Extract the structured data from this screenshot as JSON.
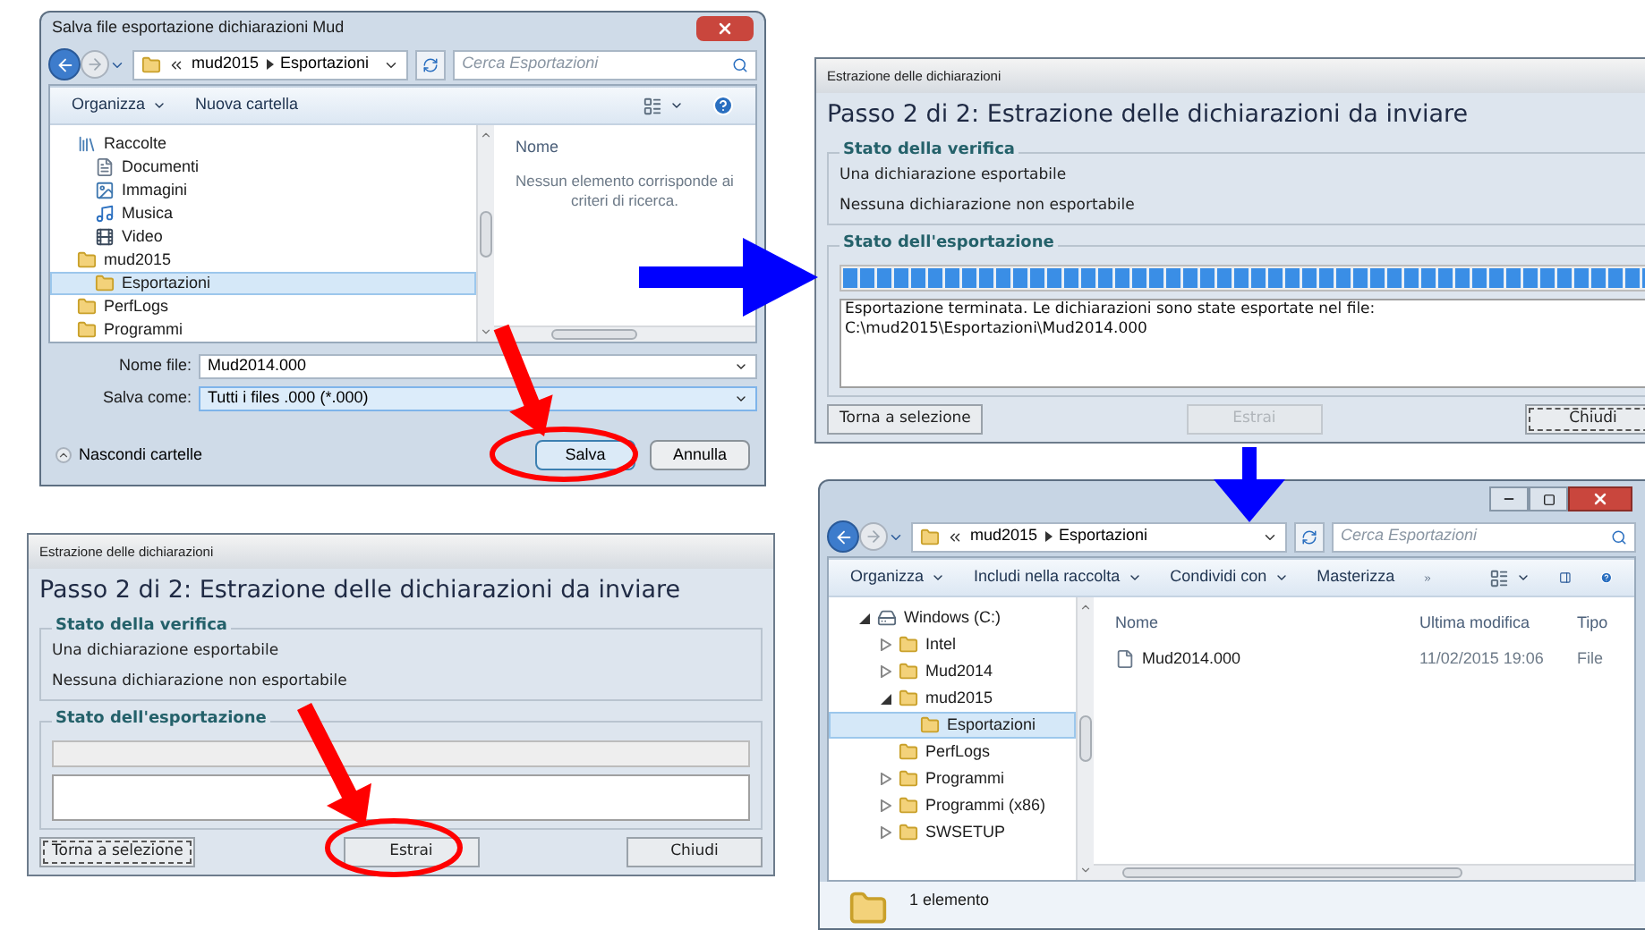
{
  "save_dialog": {
    "title": "Salva file esportazione dichiarazioni Mud",
    "breadcrumb": [
      "mud2015",
      "Esportazioni"
    ],
    "search_placeholder": "Cerca Esportazioni",
    "toolbar": [
      {
        "label": "Organizza",
        "dropdown": true
      },
      {
        "label": "Nuova cartella",
        "dropdown": false
      }
    ],
    "tree": [
      {
        "label": "Raccolte",
        "kind": "library",
        "selected": false,
        "children": [
          {
            "label": "Documenti",
            "kind": "document",
            "selected": false
          },
          {
            "label": "Immagini",
            "kind": "picture",
            "selected": false
          },
          {
            "label": "Musica",
            "kind": "music",
            "selected": false
          },
          {
            "label": "Video",
            "kind": "video",
            "selected": false
          }
        ]
      },
      {
        "label": "mud2015",
        "kind": "folder",
        "selected": false,
        "children": [
          {
            "label": "Esportazioni",
            "kind": "folder",
            "selected": true
          }
        ]
      },
      {
        "label": "PerfLogs",
        "kind": "folder",
        "selected": false
      },
      {
        "label": "Programmi",
        "kind": "folder",
        "selected": false
      }
    ],
    "column": "Nome",
    "empty_message": "Nessun elemento corrisponde ai criteri di ricerca.",
    "file_name": {
      "label": "Nome file:",
      "value": "Mud2014.000"
    },
    "save_as": {
      "label": "Salva come:",
      "value": "Tutti i files .000 (*.000)"
    },
    "hide_folders": "Nascondi cartelle",
    "buttons": [
      {
        "label": "Salva",
        "default": true
      },
      {
        "label": "Annulla",
        "default": false
      }
    ]
  },
  "completed_window": {
    "title": "Estrazione delle dichiarazioni",
    "heading": "Passo 2 di 2: Estrazione delle dichiarazioni da inviare",
    "verification_title": "Stato della verifica",
    "verification_lines": [
      "Una dichiarazione esportabile",
      "Nessuna dichiarazione non esportabile"
    ],
    "export_title": "Stato dell'esportazione",
    "progress": {
      "level": 1
    },
    "message_lines": [
      "Esportazione terminata. Le dichiarazioni sono state esportate nel file:",
      "C:\\mud2015\\Esportazioni\\Mud2014.000"
    ],
    "buttons": [
      {
        "label": "Torna a selezione",
        "disabled": false,
        "focused": false
      },
      {
        "label": "Estrai",
        "disabled": true,
        "focused": false
      },
      {
        "label": "Chiudi",
        "disabled": false,
        "focused": true
      }
    ]
  },
  "start_window": {
    "title": "Estrazione delle dichiarazioni",
    "heading": "Passo 2 di 2: Estrazione delle dichiarazioni da inviare",
    "verification_title": "Stato della verifica",
    "verification_lines": [
      "Una dichiarazione esportabile",
      "Nessuna dichiarazione non esportabile"
    ],
    "export_title": "Stato dell'esportazione",
    "progress": {
      "level": 0
    },
    "buttons": [
      {
        "label": "Torna a selezione",
        "disabled": false,
        "focused": true
      },
      {
        "label": "Estrai",
        "disabled": false,
        "focused": false
      },
      {
        "label": "Chiudi",
        "disabled": false,
        "focused": false
      }
    ]
  },
  "explorer": {
    "breadcrumb": [
      "mud2015",
      "Esportazioni"
    ],
    "search_placeholder": "Cerca Esportazioni",
    "toolbar": [
      {
        "label": "Organizza",
        "dropdown": true
      },
      {
        "label": "Includi nella raccolta",
        "dropdown": true
      },
      {
        "label": "Condividi con",
        "dropdown": true
      },
      {
        "label": "Masterizza",
        "dropdown": false
      }
    ],
    "tree": [
      {
        "label": "Windows (C:)",
        "kind": "drive",
        "selected": false,
        "expanded": true,
        "children": [
          {
            "label": "Intel",
            "kind": "folder",
            "selected": false,
            "expanded": false
          },
          {
            "label": "Mud2014",
            "kind": "folder",
            "selected": false,
            "expanded": false
          },
          {
            "label": "mud2015",
            "kind": "folder",
            "selected": false,
            "expanded": true,
            "children": [
              {
                "label": "Esportazioni",
                "kind": "folder",
                "selected": true
              }
            ]
          },
          {
            "label": "PerfLogs",
            "kind": "folder",
            "selected": false
          },
          {
            "label": "Programmi",
            "kind": "folder",
            "selected": false,
            "expanded": false
          },
          {
            "label": "Programmi (x86)",
            "kind": "folder",
            "selected": false,
            "expanded": false
          },
          {
            "label": "SWSETUP",
            "kind": "folder",
            "selected": false,
            "expanded": false
          }
        ]
      }
    ],
    "columns": [
      "Nome",
      "Ultima modifica",
      "Tipo"
    ],
    "rows": [
      {
        "kind": "file",
        "cells": [
          "Mud2014.000",
          "11/02/2015 19:06",
          "File"
        ]
      }
    ],
    "status": "1 elemento"
  }
}
